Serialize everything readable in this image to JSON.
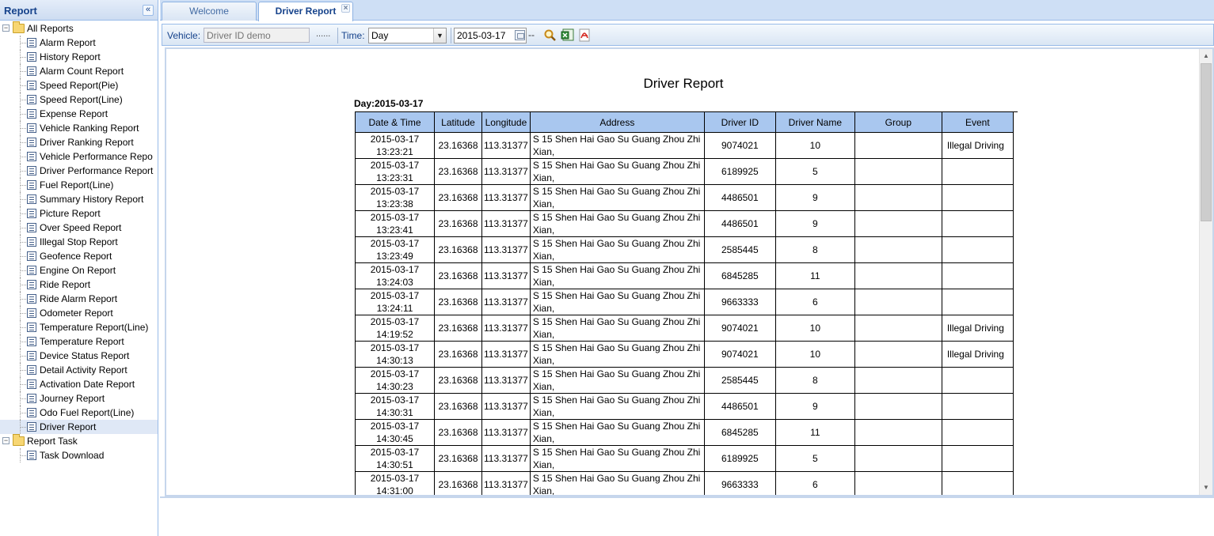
{
  "left_panel": {
    "title": "Report",
    "collapse_glyph": "«",
    "tree": [
      {
        "type": "folder",
        "label": "All Reports",
        "expanded": true,
        "toggle": "−"
      },
      {
        "type": "leaf",
        "label": "Alarm Report"
      },
      {
        "type": "leaf",
        "label": "History Report"
      },
      {
        "type": "leaf",
        "label": "Alarm Count Report"
      },
      {
        "type": "leaf",
        "label": "Speed Report(Pie)"
      },
      {
        "type": "leaf",
        "label": "Speed Report(Line)"
      },
      {
        "type": "leaf",
        "label": "Expense Report"
      },
      {
        "type": "leaf",
        "label": "Vehicle Ranking Report"
      },
      {
        "type": "leaf",
        "label": "Driver Ranking Report"
      },
      {
        "type": "leaf",
        "label": "Vehicle Performance Repo"
      },
      {
        "type": "leaf",
        "label": "Driver Performance Report"
      },
      {
        "type": "leaf",
        "label": "Fuel Report(Line)"
      },
      {
        "type": "leaf",
        "label": "Summary History Report"
      },
      {
        "type": "leaf",
        "label": "Picture Report"
      },
      {
        "type": "leaf",
        "label": "Over Speed Report"
      },
      {
        "type": "leaf",
        "label": "Illegal Stop Report"
      },
      {
        "type": "leaf",
        "label": "Geofence Report"
      },
      {
        "type": "leaf",
        "label": "Engine On Report"
      },
      {
        "type": "leaf",
        "label": "Ride Report"
      },
      {
        "type": "leaf",
        "label": "Ride Alarm Report"
      },
      {
        "type": "leaf",
        "label": "Odometer Report"
      },
      {
        "type": "leaf",
        "label": "Temperature Report(Line)"
      },
      {
        "type": "leaf",
        "label": "Temperature Report"
      },
      {
        "type": "leaf",
        "label": "Device Status Report"
      },
      {
        "type": "leaf",
        "label": "Detail Activity Report"
      },
      {
        "type": "leaf",
        "label": "Activation Date Report"
      },
      {
        "type": "leaf",
        "label": "Journey Report"
      },
      {
        "type": "leaf",
        "label": "Odo Fuel Report(Line)"
      },
      {
        "type": "leaf",
        "label": "Driver Report",
        "selected": true
      },
      {
        "type": "folder",
        "label": "Report Task",
        "expanded": true,
        "toggle": "−"
      },
      {
        "type": "leaf",
        "label": "Task Download"
      }
    ]
  },
  "tabs": {
    "welcome": "Welcome",
    "driver": "Driver Report",
    "close_glyph": "×"
  },
  "toolbar": {
    "vehicle_label": "Vehicle:",
    "vehicle_placeholder": "Driver ID demo",
    "vehicle_more": "......",
    "time_label": "Time:",
    "time_value": "Day",
    "time_arrow": "▼",
    "date_value": "2015-03-17",
    "date_dash": "--",
    "icons": [
      "search-icon",
      "export-excel-icon",
      "export-pdf-icon"
    ]
  },
  "report": {
    "title": "Driver Report",
    "day_label": "Day:2015-03-17",
    "columns": [
      "Date & Time",
      "Latitude",
      "Longitude",
      "Address",
      "Driver ID",
      "Driver Name",
      "Group",
      "Event"
    ],
    "rows": [
      {
        "date": "2015-03-17",
        "time": "13:23:21",
        "lat": "23.16368",
        "lng": "113.31377",
        "addr1": "S 15 Shen Hai Gao Su Guang Zhou Zhi",
        "addr2": "Xian,",
        "driver_id": "9074021",
        "driver_name": "10",
        "group": "",
        "event": "Illegal Driving"
      },
      {
        "date": "2015-03-17",
        "time": "13:23:31",
        "lat": "23.16368",
        "lng": "113.31377",
        "addr1": "S 15 Shen Hai Gao Su Guang Zhou Zhi",
        "addr2": "Xian,",
        "driver_id": "6189925",
        "driver_name": "5",
        "group": "",
        "event": ""
      },
      {
        "date": "2015-03-17",
        "time": "13:23:38",
        "lat": "23.16368",
        "lng": "113.31377",
        "addr1": "S 15 Shen Hai Gao Su Guang Zhou Zhi",
        "addr2": "Xian,",
        "driver_id": "4486501",
        "driver_name": "9",
        "group": "",
        "event": ""
      },
      {
        "date": "2015-03-17",
        "time": "13:23:41",
        "lat": "23.16368",
        "lng": "113.31377",
        "addr1": "S 15 Shen Hai Gao Su Guang Zhou Zhi",
        "addr2": "Xian,",
        "driver_id": "4486501",
        "driver_name": "9",
        "group": "",
        "event": ""
      },
      {
        "date": "2015-03-17",
        "time": "13:23:49",
        "lat": "23.16368",
        "lng": "113.31377",
        "addr1": "S 15 Shen Hai Gao Su Guang Zhou Zhi",
        "addr2": "Xian,",
        "driver_id": "2585445",
        "driver_name": "8",
        "group": "",
        "event": ""
      },
      {
        "date": "2015-03-17",
        "time": "13:24:03",
        "lat": "23.16368",
        "lng": "113.31377",
        "addr1": "S 15 Shen Hai Gao Su Guang Zhou Zhi",
        "addr2": "Xian,",
        "driver_id": "6845285",
        "driver_name": "11",
        "group": "",
        "event": ""
      },
      {
        "date": "2015-03-17",
        "time": "13:24:11",
        "lat": "23.16368",
        "lng": "113.31377",
        "addr1": "S 15 Shen Hai Gao Su Guang Zhou Zhi",
        "addr2": "Xian,",
        "driver_id": "9663333",
        "driver_name": "6",
        "group": "",
        "event": ""
      },
      {
        "date": "2015-03-17",
        "time": "14:19:52",
        "lat": "23.16368",
        "lng": "113.31377",
        "addr1": "S 15 Shen Hai Gao Su Guang Zhou Zhi",
        "addr2": "Xian,",
        "driver_id": "9074021",
        "driver_name": "10",
        "group": "",
        "event": "Illegal Driving"
      },
      {
        "date": "2015-03-17",
        "time": "14:30:13",
        "lat": "23.16368",
        "lng": "113.31377",
        "addr1": "S 15 Shen Hai Gao Su Guang Zhou Zhi",
        "addr2": "Xian,",
        "driver_id": "9074021",
        "driver_name": "10",
        "group": "",
        "event": "Illegal Driving"
      },
      {
        "date": "2015-03-17",
        "time": "14:30:23",
        "lat": "23.16368",
        "lng": "113.31377",
        "addr1": "S 15 Shen Hai Gao Su Guang Zhou Zhi",
        "addr2": "Xian,",
        "driver_id": "2585445",
        "driver_name": "8",
        "group": "",
        "event": ""
      },
      {
        "date": "2015-03-17",
        "time": "14:30:31",
        "lat": "23.16368",
        "lng": "113.31377",
        "addr1": "S 15 Shen Hai Gao Su Guang Zhou Zhi",
        "addr2": "Xian,",
        "driver_id": "4486501",
        "driver_name": "9",
        "group": "",
        "event": ""
      },
      {
        "date": "2015-03-17",
        "time": "14:30:45",
        "lat": "23.16368",
        "lng": "113.31377",
        "addr1": "S 15 Shen Hai Gao Su Guang Zhou Zhi",
        "addr2": "Xian,",
        "driver_id": "6845285",
        "driver_name": "11",
        "group": "",
        "event": ""
      },
      {
        "date": "2015-03-17",
        "time": "14:30:51",
        "lat": "23.16368",
        "lng": "113.31377",
        "addr1": "S 15 Shen Hai Gao Su Guang Zhou Zhi",
        "addr2": "Xian,",
        "driver_id": "6189925",
        "driver_name": "5",
        "group": "",
        "event": ""
      },
      {
        "date": "2015-03-17",
        "time": "14:31:00",
        "lat": "23.16368",
        "lng": "113.31377",
        "addr1": "S 15 Shen Hai Gao Su Guang Zhou Zhi",
        "addr2": "Xian,",
        "driver_id": "9663333",
        "driver_name": "6",
        "group": "",
        "event": ""
      }
    ]
  },
  "scrollbar": {
    "up_glyph": "▲",
    "down_glyph": "▼"
  },
  "colors": {
    "header_text": "#15428b",
    "table_header_bg": "#a9c7ef",
    "panel_border": "#99bbe8",
    "selected_row_bg": "#dfe8f6"
  }
}
